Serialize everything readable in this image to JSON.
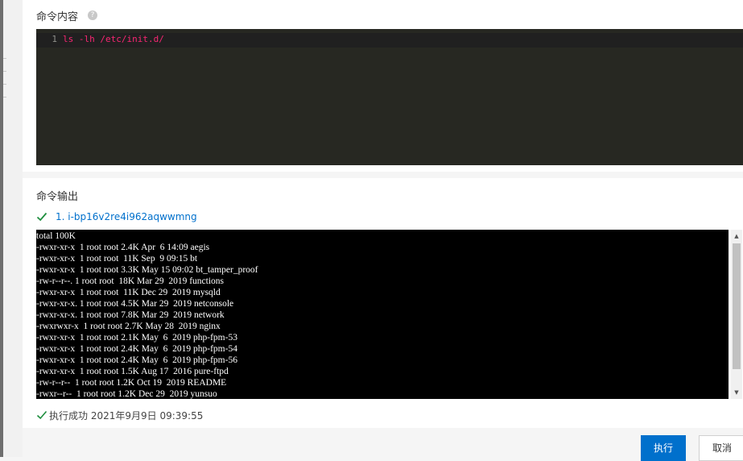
{
  "command_section": {
    "label": "命令内容",
    "help_icon": "question-circle-icon",
    "editor": {
      "line_number": "1",
      "code": "ls -lh /etc/init.d/"
    }
  },
  "output_section": {
    "label": "命令输出",
    "instance": {
      "status_icon": "check-icon",
      "label": "1.  i-bp16v2re4i962aqwwmng"
    },
    "terminal_lines": [
      "total 100K",
      "-rwxr-xr-x  1 root root 2.4K Apr  6 14:09 aegis",
      "-rwxr-xr-x  1 root root  11K Sep  9 09:15 bt",
      "-rwxr-xr-x  1 root root 3.3K May 15 09:02 bt_tamper_proof",
      "-rw-r--r--. 1 root root  18K Mar 29  2019 functions",
      "-rwxr-xr-x  1 root root  11K Dec 29  2019 mysqld",
      "-rwxr-xr-x. 1 root root 4.5K Mar 29  2019 netconsole",
      "-rwxr-xr-x. 1 root root 7.8K Mar 29  2019 network",
      "-rwxrwxr-x  1 root root 2.7K May 28  2019 nginx",
      "-rwxr-xr-x  1 root root 2.1K May  6  2019 php-fpm-53",
      "-rwxr-xr-x  1 root root 2.4K May  6  2019 php-fpm-54",
      "-rwxr-xr-x  1 root root 2.4K May  6  2019 php-fpm-56",
      "-rwxr-xr-x  1 root root 1.5K Aug 17  2016 pure-ftpd",
      "-rw-r--r--  1 root root 1.2K Oct 19  2019 README",
      "-rwxr--r--  1 root root 1.2K Dec 29  2019 yunsuo"
    ],
    "status": {
      "icon": "check-icon",
      "text": "执行成功 2021年9月9日 09:39:55"
    }
  },
  "footer": {
    "execute_label": "执行",
    "cancel_label": "取消"
  },
  "colors": {
    "primary": "#0070cc",
    "success": "#1e8e3e",
    "editor_bg": "#272822",
    "terminal_bg": "#000000"
  }
}
